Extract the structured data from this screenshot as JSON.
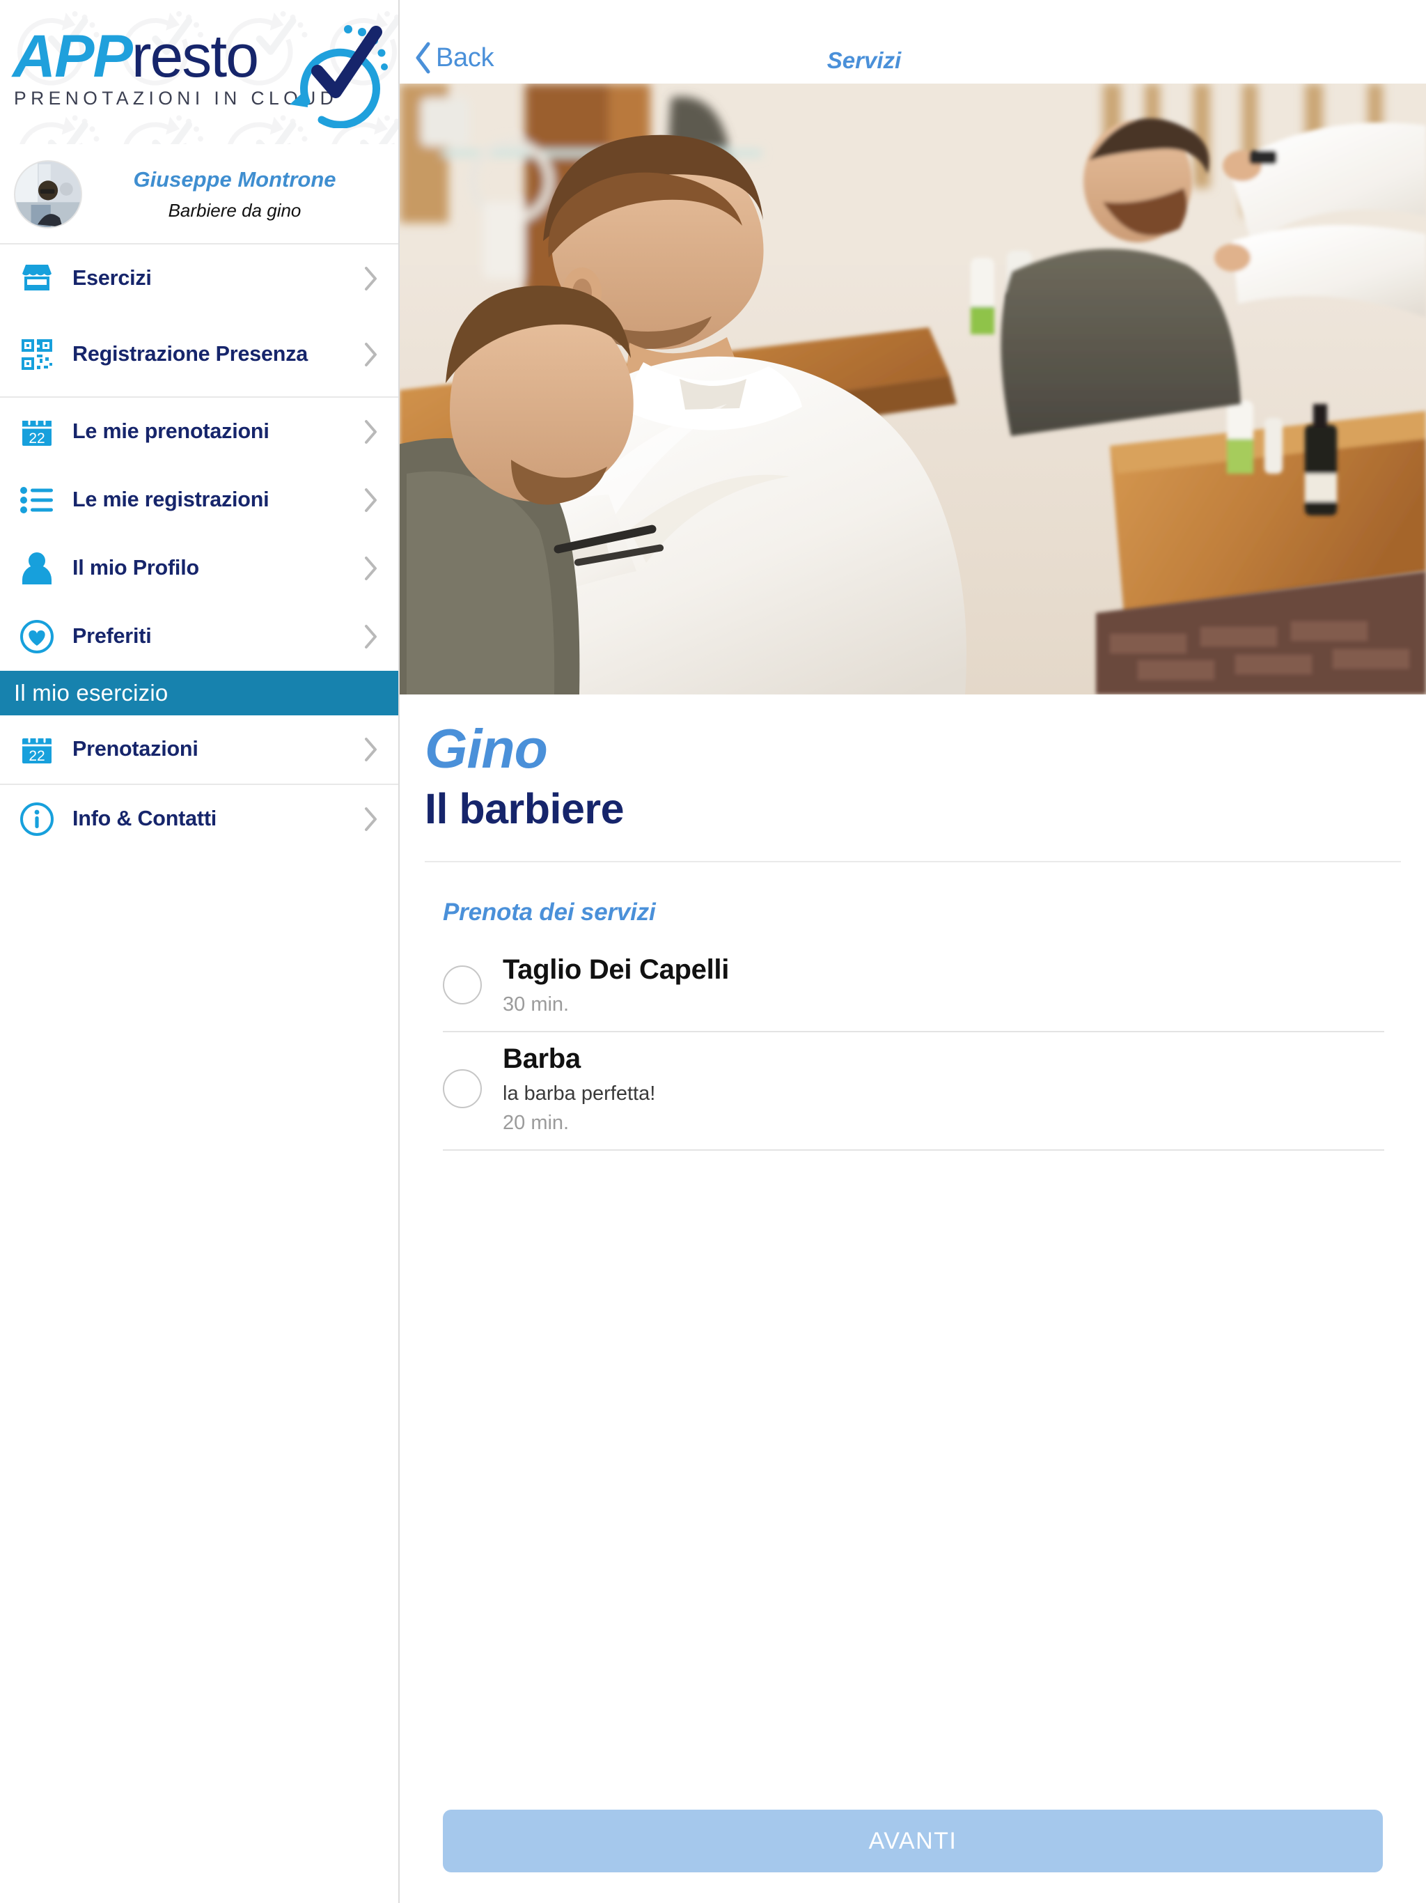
{
  "brand": {
    "logo_app": "APP",
    "logo_resto": "resto",
    "logo_tagline": "PRENOTAZIONI IN CLOUD",
    "accent_blue": "#1fa0dc",
    "navy": "#16256b",
    "band_teal": "#1782ae",
    "link_blue": "#4a90d9",
    "cta_blue": "#a5c8ec"
  },
  "profile": {
    "name": "Giuseppe Montrone",
    "role": "Barbiere da gino"
  },
  "sidebar": {
    "group1": [
      {
        "label": "Esercizi",
        "icon": "storefront-icon"
      },
      {
        "label": "Registrazione Presenza",
        "icon": "qr-code-icon"
      }
    ],
    "group2": [
      {
        "label": "Le mie prenotazioni",
        "icon": "calendar-22-icon"
      },
      {
        "label": "Le mie registrazioni",
        "icon": "bullet-list-icon"
      },
      {
        "label": "Il mio Profilo",
        "icon": "person-icon"
      },
      {
        "label": "Preferiti",
        "icon": "heart-circle-icon"
      }
    ],
    "section_header": "Il mio esercizio",
    "group3": [
      {
        "label": "Prenotazioni",
        "icon": "calendar-22-icon"
      }
    ],
    "group4": [
      {
        "label": "Info & Contatti",
        "icon": "info-circle-icon"
      }
    ]
  },
  "topbar": {
    "back_label": "Back",
    "title": "Servizi"
  },
  "shop": {
    "name": "Gino",
    "subtitle": "Il barbiere"
  },
  "services_section": {
    "title": "Prenota dei servizi",
    "items": [
      {
        "name": "Taglio Dei Capelli",
        "description": "",
        "duration": "30 min.",
        "selected": false
      },
      {
        "name": "Barba",
        "description": "la barba perfetta!",
        "duration": "20 min.",
        "selected": false
      }
    ]
  },
  "footer": {
    "cta_label": "AVANTI"
  }
}
